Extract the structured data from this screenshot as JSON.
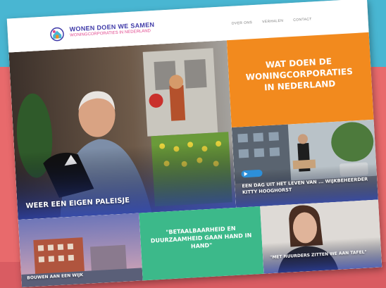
{
  "site": {
    "brand_title": "WONEN DOEN WE SAMEN",
    "brand_subtitle": "WONINGCORPORATIES IN NEDERLAND"
  },
  "nav": {
    "items": [
      "OVER ONS",
      "VERHALEN",
      "CONTACT"
    ]
  },
  "tiles": {
    "hero_caption": "WEER EEN EIGEN PALEISJE",
    "orange_heading": "WAT DOEN DE WONINGCORPORATIES IN NEDERLAND",
    "street_caption": "EEN DAG UIT HET LEVEN VAN ... WIJKBEHEERDER KITTY HOOGHORST",
    "city_caption": "BOUWEN AAN EEN WIJK",
    "green_quote": "\"BETAALBAARHEID EN DUURZAAMHEID GAAN HAND IN HAND\"",
    "portrait_caption": "\"MET HUURDERS ZITTEN WE AAN TAFEL\""
  },
  "colors": {
    "orange_tile": "#f28a1e",
    "green_tile": "#3cb98a",
    "brand_purple": "#3f3aa8",
    "brand_pink": "#e0458c"
  }
}
